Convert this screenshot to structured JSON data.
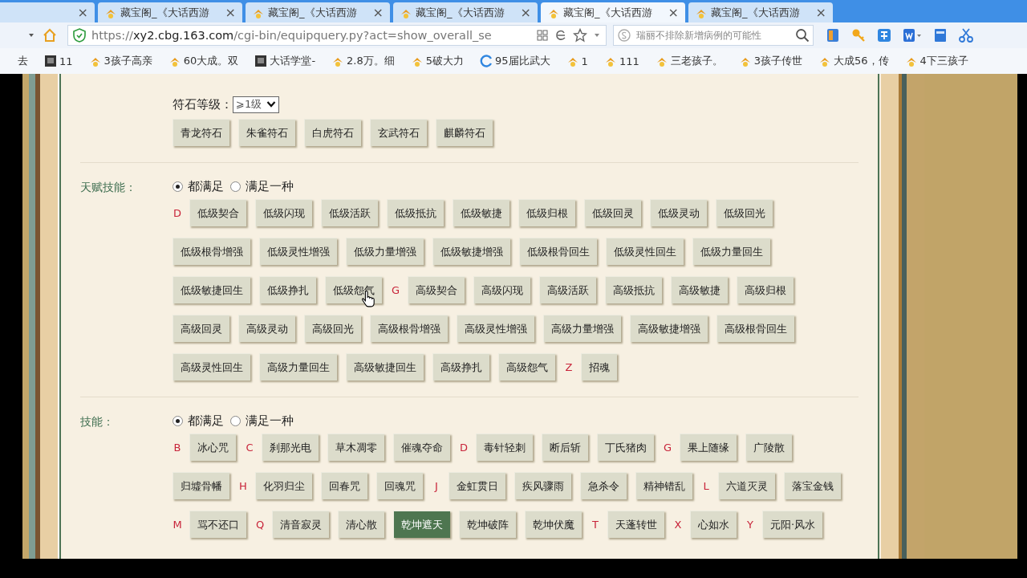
{
  "browser": {
    "tabs": [
      {
        "close": "×",
        "selected": false
      },
      {
        "title": "藏宝阁_《大话西游",
        "close": "×",
        "selected": false
      },
      {
        "title": "藏宝阁_《大话西游",
        "close": "×",
        "selected": false
      },
      {
        "title": "藏宝阁_《大话西游",
        "close": "×",
        "selected": false
      },
      {
        "title": "藏宝阁_《大话西游",
        "close": "×",
        "selected": true
      },
      {
        "title": "藏宝阁_《大话西游",
        "close": "×",
        "selected": false
      }
    ],
    "url_scheme": "https://",
    "url_host": "xy2.cbg.163.com",
    "url_path": "/cgi-bin/equipquery.py?act=show_overall_se",
    "search": {
      "placeholder": "瑞丽不排除新增病例的可能性"
    },
    "bookmarks": [
      {
        "label": "去",
        "kind": "plain"
      },
      {
        "label": "11",
        "kind": "page"
      },
      {
        "label": "3孩子高亲",
        "kind": "game"
      },
      {
        "label": "60大成。双",
        "kind": "game"
      },
      {
        "label": "大话学堂-",
        "kind": "page"
      },
      {
        "label": "2.8万。细",
        "kind": "game"
      },
      {
        "label": "5破大力",
        "kind": "game"
      },
      {
        "label": "95届比武大",
        "kind": "web"
      },
      {
        "label": "1",
        "kind": "game"
      },
      {
        "label": "111",
        "kind": "game"
      },
      {
        "label": "三老孩子。",
        "kind": "game"
      },
      {
        "label": "3孩子传世",
        "kind": "game"
      },
      {
        "label": "大成56，传",
        "kind": "game"
      },
      {
        "label": "4下三孩子",
        "kind": "game"
      }
    ]
  },
  "sections": [
    {
      "grade": {
        "label": "符石等级：",
        "value": "⩾1级"
      },
      "rows": [
        {
          "items": [
            {
              "kind": "option",
              "text": "青龙符石",
              "selected": false
            },
            {
              "kind": "option",
              "text": "朱雀符石",
              "selected": false
            },
            {
              "kind": "option",
              "text": "白虎符石",
              "selected": false
            },
            {
              "kind": "option",
              "text": "玄武符石",
              "selected": false
            },
            {
              "kind": "option",
              "text": "麒麟符石",
              "selected": false
            }
          ]
        }
      ]
    },
    {
      "label": "天赋技能：",
      "options": [
        {
          "label": "都满足",
          "selected": true
        },
        {
          "label": "满足一种",
          "selected": false
        }
      ],
      "rows": [
        {
          "items": [
            {
              "kind": "letter",
              "text": "D"
            },
            {
              "kind": "option",
              "text": "低级契合",
              "selected": false
            },
            {
              "kind": "option",
              "text": "低级闪现",
              "selected": false
            },
            {
              "kind": "option",
              "text": "低级活跃",
              "selected": false
            },
            {
              "kind": "option",
              "text": "低级抵抗",
              "selected": false
            },
            {
              "kind": "option",
              "text": "低级敏捷",
              "selected": false
            },
            {
              "kind": "option",
              "text": "低级归根",
              "selected": false
            },
            {
              "kind": "option",
              "text": "低级回灵",
              "selected": false
            },
            {
              "kind": "option",
              "text": "低级灵动",
              "selected": false
            },
            {
              "kind": "option",
              "text": "低级回光",
              "selected": false
            }
          ]
        },
        {
          "items": [
            {
              "kind": "option",
              "text": "低级根骨增强",
              "selected": false
            },
            {
              "kind": "option",
              "text": "低级灵性增强",
              "selected": false
            },
            {
              "kind": "option",
              "text": "低级力量增强",
              "selected": false
            },
            {
              "kind": "option",
              "text": "低级敏捷增强",
              "selected": false
            },
            {
              "kind": "option",
              "text": "低级根骨回生",
              "selected": false
            },
            {
              "kind": "option",
              "text": "低级灵性回生",
              "selected": false
            },
            {
              "kind": "option",
              "text": "低级力量回生",
              "selected": false
            }
          ]
        },
        {
          "items": [
            {
              "kind": "option",
              "text": "低级敏捷回生",
              "selected": false
            },
            {
              "kind": "option",
              "text": "低级挣扎",
              "selected": false
            },
            {
              "kind": "option",
              "text": "低级怨气",
              "selected": false
            },
            {
              "kind": "letter",
              "text": "G"
            },
            {
              "kind": "option",
              "text": "高级契合",
              "selected": false
            },
            {
              "kind": "option",
              "text": "高级闪现",
              "selected": false
            },
            {
              "kind": "option",
              "text": "高级活跃",
              "selected": false
            },
            {
              "kind": "option",
              "text": "高级抵抗",
              "selected": false
            },
            {
              "kind": "option",
              "text": "高级敏捷",
              "selected": false
            },
            {
              "kind": "option",
              "text": "高级归根",
              "selected": false
            }
          ]
        },
        {
          "items": [
            {
              "kind": "option",
              "text": "高级回灵",
              "selected": false
            },
            {
              "kind": "option",
              "text": "高级灵动",
              "selected": false
            },
            {
              "kind": "option",
              "text": "高级回光",
              "selected": false
            },
            {
              "kind": "option",
              "text": "高级根骨增强",
              "selected": false
            },
            {
              "kind": "option",
              "text": "高级灵性增强",
              "selected": false
            },
            {
              "kind": "option",
              "text": "高级力量增强",
              "selected": false
            },
            {
              "kind": "option",
              "text": "高级敏捷增强",
              "selected": false
            },
            {
              "kind": "option",
              "text": "高级根骨回生",
              "selected": false
            }
          ]
        },
        {
          "items": [
            {
              "kind": "option",
              "text": "高级灵性回生",
              "selected": false
            },
            {
              "kind": "option",
              "text": "高级力量回生",
              "selected": false
            },
            {
              "kind": "option",
              "text": "高级敏捷回生",
              "selected": false
            },
            {
              "kind": "option",
              "text": "高级挣扎",
              "selected": false
            },
            {
              "kind": "option",
              "text": "高级怨气",
              "selected": false
            },
            {
              "kind": "letter",
              "text": "Z"
            },
            {
              "kind": "option",
              "text": "招魂",
              "selected": false
            }
          ]
        }
      ]
    },
    {
      "label": "技能：",
      "options": [
        {
          "label": "都满足",
          "selected": true
        },
        {
          "label": "满足一种",
          "selected": false
        }
      ],
      "rows": [
        {
          "items": [
            {
              "kind": "letter",
              "text": "B"
            },
            {
              "kind": "option",
              "text": "冰心咒",
              "selected": false
            },
            {
              "kind": "letter",
              "text": "C"
            },
            {
              "kind": "option",
              "text": "刹那光电",
              "selected": false
            },
            {
              "kind": "option",
              "text": "草木凋零",
              "selected": false
            },
            {
              "kind": "option",
              "text": "催魂夺命",
              "selected": false
            },
            {
              "kind": "letter",
              "text": "D"
            },
            {
              "kind": "option",
              "text": "毒针轻刺",
              "selected": false
            },
            {
              "kind": "option",
              "text": "断后斩",
              "selected": false
            },
            {
              "kind": "option",
              "text": "丁氏猪肉",
              "selected": false
            },
            {
              "kind": "letter",
              "text": "G"
            },
            {
              "kind": "option",
              "text": "果上随缘",
              "selected": false
            },
            {
              "kind": "option",
              "text": "广陵散",
              "selected": false
            }
          ]
        },
        {
          "items": [
            {
              "kind": "option",
              "text": "归墟骨幡",
              "selected": false
            },
            {
              "kind": "letter",
              "text": "H"
            },
            {
              "kind": "option",
              "text": "化羽归尘",
              "selected": false
            },
            {
              "kind": "option",
              "text": "回春咒",
              "selected": false
            },
            {
              "kind": "option",
              "text": "回魂咒",
              "selected": false
            },
            {
              "kind": "letter",
              "text": "J"
            },
            {
              "kind": "option",
              "text": "金虹贯日",
              "selected": false
            },
            {
              "kind": "option",
              "text": "疾风骤雨",
              "selected": false
            },
            {
              "kind": "option",
              "text": "急杀令",
              "selected": false
            },
            {
              "kind": "option",
              "text": "精神错乱",
              "selected": false
            },
            {
              "kind": "letter",
              "text": "L"
            },
            {
              "kind": "option",
              "text": "六道灭灵",
              "selected": false
            },
            {
              "kind": "option",
              "text": "落宝金钱",
              "selected": false
            }
          ]
        },
        {
          "items": [
            {
              "kind": "letter",
              "text": "M"
            },
            {
              "kind": "option",
              "text": "骂不还口",
              "selected": false
            },
            {
              "kind": "letter",
              "text": "Q"
            },
            {
              "kind": "option",
              "text": "清音寂灵",
              "selected": false
            },
            {
              "kind": "option",
              "text": "清心散",
              "selected": false
            },
            {
              "kind": "option",
              "text": "乾坤遮天",
              "selected": true
            },
            {
              "kind": "option",
              "text": "乾坤破阵",
              "selected": false
            },
            {
              "kind": "option",
              "text": "乾坤伏魔",
              "selected": false
            },
            {
              "kind": "letter",
              "text": "T"
            },
            {
              "kind": "option",
              "text": "天蓬转世",
              "selected": false
            },
            {
              "kind": "letter",
              "text": "X"
            },
            {
              "kind": "option",
              "text": "心如水",
              "selected": false
            },
            {
              "kind": "letter",
              "text": "Y"
            },
            {
              "kind": "option",
              "text": "元阳·风水",
              "selected": false
            }
          ]
        }
      ]
    }
  ]
}
